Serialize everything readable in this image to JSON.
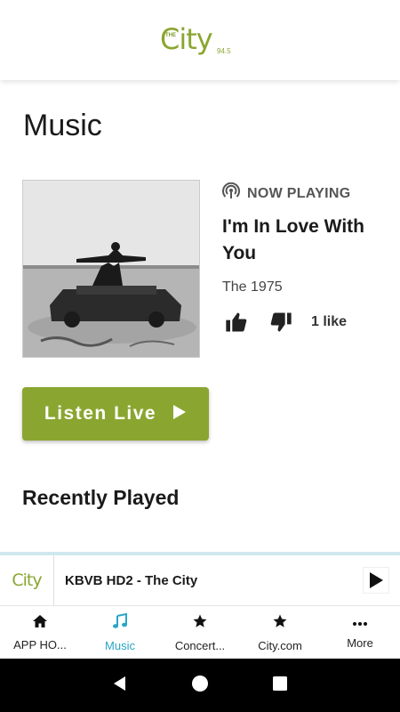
{
  "header": {
    "logo": {
      "the": "THE",
      "city": "City",
      "freq": "94.5"
    }
  },
  "page": {
    "title": "Music"
  },
  "now_playing": {
    "label": "NOW PLAYING",
    "song": "I'm In Love With You",
    "artist": "The 1975",
    "likes": "1 like"
  },
  "listen_button": {
    "label": "Listen Live"
  },
  "recent": {
    "heading": "Recently Played"
  },
  "mini_player": {
    "logo": "City",
    "station": "KBVB HD2 - The City"
  },
  "bottom_nav": {
    "items": [
      {
        "label": "APP HO...",
        "icon": "home-icon"
      },
      {
        "label": "Music",
        "icon": "music-note-icon",
        "active": true
      },
      {
        "label": "Concert...",
        "icon": "star-icon"
      },
      {
        "label": "City.com",
        "icon": "star-icon"
      },
      {
        "label": "More",
        "icon": "more-dots-icon"
      }
    ]
  },
  "colors": {
    "brand": "#8aa630",
    "active_tab": "#29a5c6",
    "accent_border": "#cfe8ee"
  }
}
